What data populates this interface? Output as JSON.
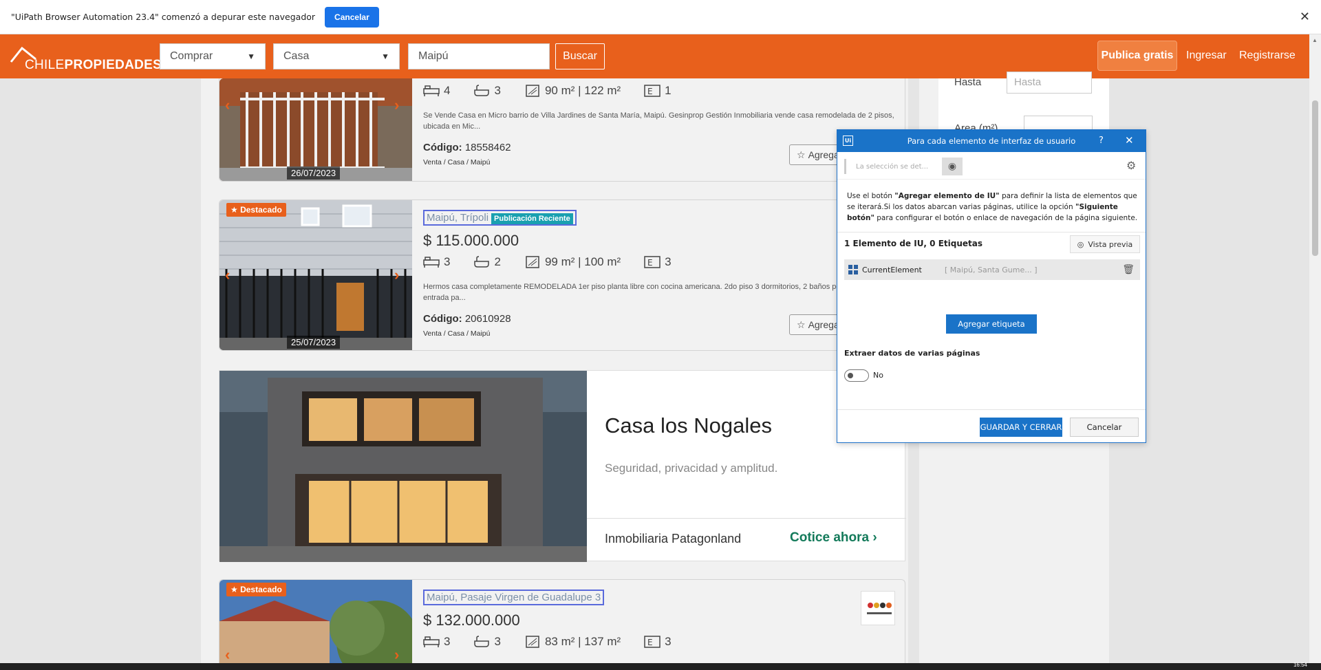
{
  "debug_bar": {
    "message": "\"UiPath Browser Automation 23.4\" comenzó a depurar este navegador",
    "cancel_label": "Cancelar",
    "close_glyph": "✕"
  },
  "header": {
    "logo_light": "CHILE",
    "logo_bold": "PROPIEDADES",
    "operation": "Comprar",
    "property_type": "Casa",
    "location_value": "Maipú",
    "search_label": "Buscar",
    "publish_label": "Publica gratis",
    "login_label": "Ingresar",
    "register_label": "Registrarse"
  },
  "filters": {
    "hasta_label": "Hasta",
    "hasta_placeholder": "Hasta",
    "area_label": "Area (m²)"
  },
  "listings": [
    {
      "bedrooms": "4",
      "bathrooms": "3",
      "area": "90 m² | 122 m²",
      "parking": "1",
      "description": "Se Vende Casa en Micro barrio de Villa Jardines de Santa María, Maipú. Gesinprop Gestión Inmobiliaria vende casa remodelada de 2 pisos, ubicada en Mic...",
      "code_label": "Código:",
      "code": "18558462",
      "breadcrumb": "Venta / Casa / Maipú",
      "date": "26/07/2023",
      "add_label": "Agrega"
    },
    {
      "badge": "Destacado",
      "title": "Maipú, Trípoli",
      "recent_badge": "Publicación Reciente",
      "price": "$ 115.000.000",
      "bedrooms": "3",
      "bathrooms": "2",
      "area": "99 m² | 100 m²",
      "parking": "3",
      "description": "Hermos casa completamente REMODELADA 1er piso planta libre con cocina americana. 2do piso 3 dormitorios, 2 baños por un lado. entrada pa...",
      "code_label": "Código:",
      "code": "20610928",
      "breadcrumb": "Venta / Casa / Maipú",
      "date": "25/07/2023",
      "add_label": "Agrega"
    },
    {
      "badge": "Destacado",
      "title": "Maipú, Pasaje Virgen de Guadalupe 3",
      "price": "$ 132.000.000",
      "bedrooms": "3",
      "bathrooms": "3",
      "area": "83 m² | 137 m²",
      "parking": "3"
    }
  ],
  "ad": {
    "title": "Casa los Nogales",
    "subtitle": "Seguridad, privacidad y amplitud.",
    "company": "Inmobiliaria Patagonland",
    "cta": "Cotice ahora"
  },
  "dialog": {
    "title": "Para cada elemento de interfaz de usuario",
    "help": "?",
    "close": "✕",
    "selection_placeholder": "La selección se det...",
    "info_1": "Use el botón ",
    "info_b1": "\"Agregar elemento de IU\"",
    "info_2": " para definir la lista de elementos que se iterará.Si los datos abarcan varias páginas, utilice la opción ",
    "info_b2": "\"Siguiente botón\"",
    "info_3": " para configurar el botón o enlace de navegación de la página siguiente.",
    "count_label": "1 Elemento de IU, 0 Etiquetas",
    "preview_label": "Vista previa",
    "element_name": "CurrentElement",
    "element_selector": "[ Maipú, Santa Gume... ]",
    "add_label_button": "Agregar etiqueta",
    "extract_label": "Extraer datos de varias páginas",
    "toggle_value": "No",
    "save_button": "GUARDAR Y CERRAR",
    "cancel_button": "Cancelar"
  },
  "taskbar": {
    "time": "16:54"
  },
  "colors": {
    "brand": "#e8601c",
    "dialog_blue": "#1a73c8",
    "cta_green": "#137a5a"
  }
}
